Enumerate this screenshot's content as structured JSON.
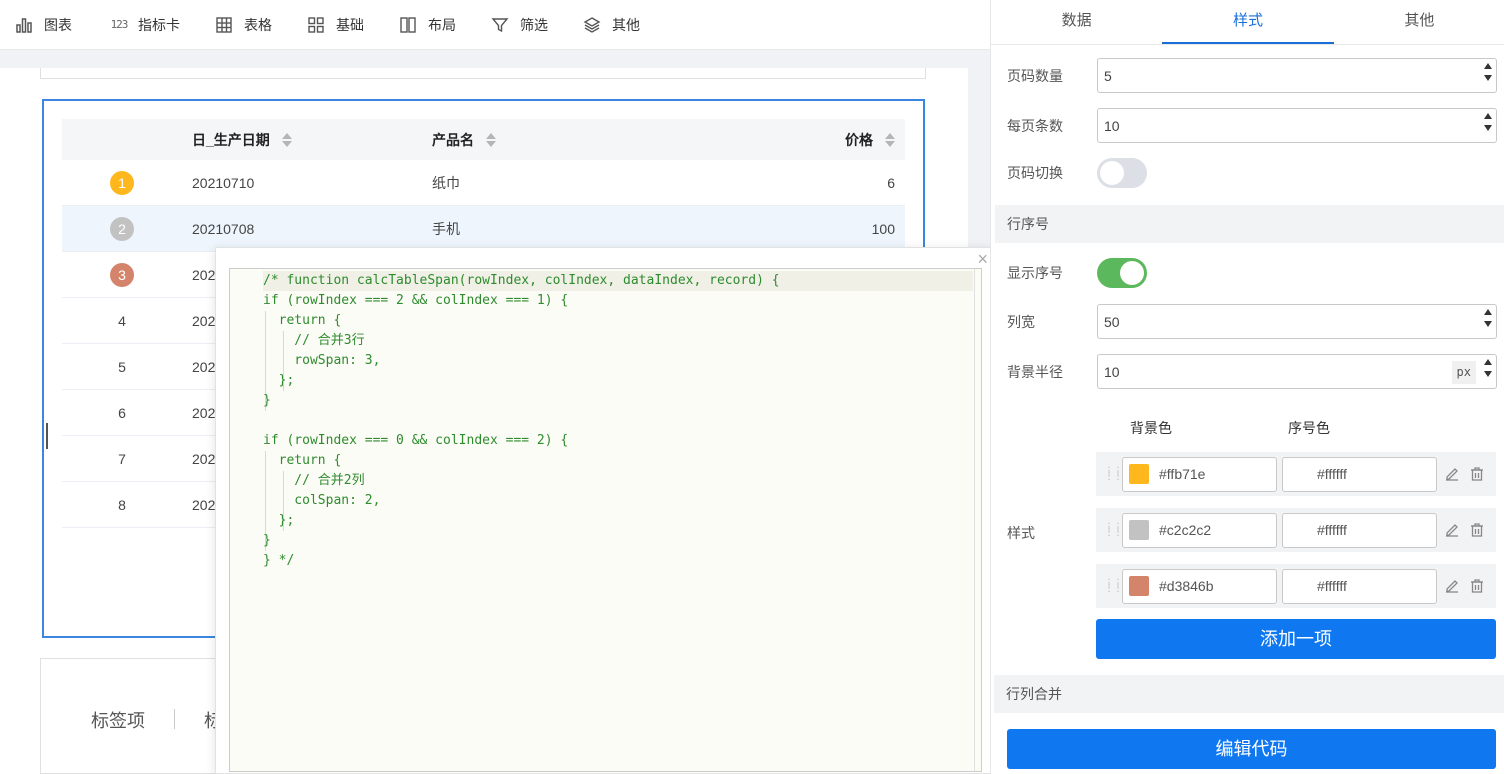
{
  "toolbar": {
    "items": [
      {
        "label": "图表",
        "icon": "bar-chart-icon"
      },
      {
        "label": "指标卡",
        "icon": "number-icon",
        "glyph": "123"
      },
      {
        "label": "表格",
        "icon": "table-grid-icon"
      },
      {
        "label": "基础",
        "icon": "components-icon"
      },
      {
        "label": "布局",
        "icon": "layout-columns-icon"
      },
      {
        "label": "筛选",
        "icon": "filter-icon"
      },
      {
        "label": "其他",
        "icon": "layers-icon"
      }
    ]
  },
  "table": {
    "columns": [
      "日_生产日期",
      "产品名",
      "价格"
    ],
    "rows": [
      {
        "index": "1",
        "date": "20210710",
        "name": "纸巾",
        "price": "6",
        "badge_color": "#ffb71e"
      },
      {
        "index": "2",
        "date": "20210708",
        "name": "手机",
        "price": "100",
        "badge_color": "#c2c2c2"
      },
      {
        "index": "3",
        "date": "202",
        "badge_color": "#d3846b"
      },
      {
        "index": "4",
        "date": "202"
      },
      {
        "index": "5",
        "date": "202"
      },
      {
        "index": "6",
        "date": "202"
      },
      {
        "index": "7",
        "date": "202"
      },
      {
        "index": "8",
        "date": "202"
      }
    ]
  },
  "tabs_card": {
    "tab1": "标签项",
    "tab2_partial": "标"
  },
  "code_editor": {
    "close": "×",
    "lines": [
      "/* function calcTableSpan(rowIndex, colIndex, dataIndex, record) {",
      "if (rowIndex === 2 && colIndex === 1) {",
      "  return {",
      "    // 合并3行",
      "    rowSpan: 3,",
      "  };",
      "}",
      "",
      "if (rowIndex === 0 && colIndex === 2) {",
      "  return {",
      "    // 合并2列",
      "    colSpan: 2,",
      "  };",
      "}",
      "} */"
    ]
  },
  "panel": {
    "tabs": [
      "数据",
      "样式",
      "其他"
    ],
    "active_tab": "样式",
    "page_count_label": "页码数量",
    "page_count_value": "5",
    "page_size_label": "每页条数",
    "page_size_value": "10",
    "page_switch_label": "页码切换",
    "page_switch_on": false,
    "row_index_section": "行序号",
    "show_index_label": "显示序号",
    "show_index_on": true,
    "col_width_label": "列宽",
    "col_width_value": "50",
    "bg_radius_label": "背景半径",
    "bg_radius_value": "10",
    "bg_radius_unit": "px",
    "bg_color_head": "背景色",
    "index_color_head": "序号色",
    "style_label": "样式",
    "color_rows": [
      {
        "bg": "#ffb71e",
        "fg": "#ffffff"
      },
      {
        "bg": "#c2c2c2",
        "fg": "#ffffff"
      },
      {
        "bg": "#d3846b",
        "fg": "#ffffff"
      }
    ],
    "add_item_button": "添加一项",
    "merge_section": "行列合并",
    "edit_code_button": "编辑代码"
  }
}
